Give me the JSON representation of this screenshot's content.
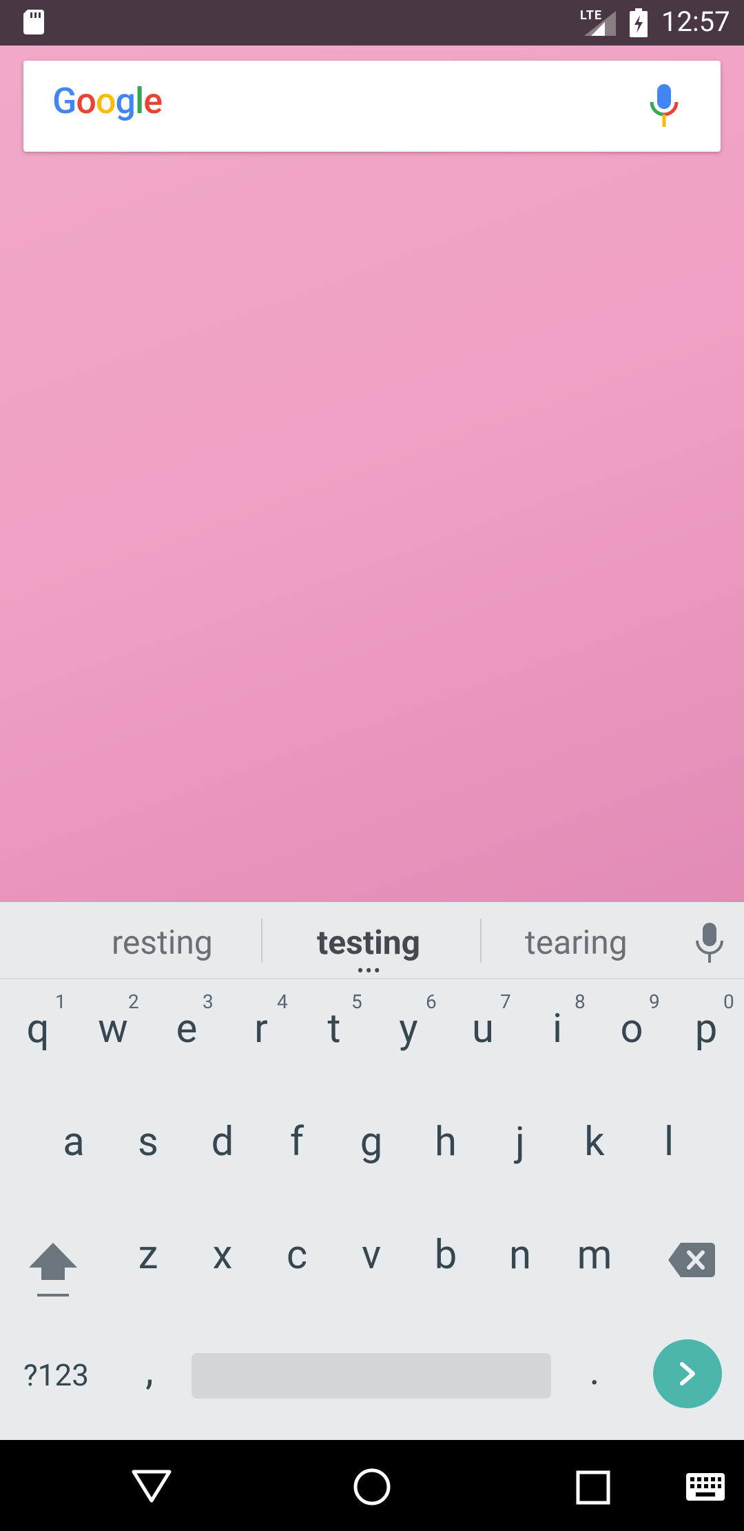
{
  "status_bar": {
    "network_label": "LTE",
    "time": "12:57"
  },
  "search_widget": {
    "logo_text": "Google",
    "logo_colors": [
      "#4285F4",
      "#EA4335",
      "#FBBC05",
      "#4285F4",
      "#34A853",
      "#EA4335"
    ],
    "mic_icon": "mic-icon"
  },
  "keyboard": {
    "suggestions": [
      "resting",
      "testing",
      "tearing"
    ],
    "row1_keys": [
      "q",
      "w",
      "e",
      "r",
      "t",
      "y",
      "u",
      "i",
      "o",
      "p"
    ],
    "row1_numbers": [
      "1",
      "2",
      "3",
      "4",
      "5",
      "6",
      "7",
      "8",
      "9",
      "0"
    ],
    "row2_keys": [
      "a",
      "s",
      "d",
      "f",
      "g",
      "h",
      "j",
      "k",
      "l"
    ],
    "row3_keys": [
      "z",
      "x",
      "c",
      "v",
      "b",
      "n",
      "m"
    ],
    "symbols_label": "?123",
    "comma": ",",
    "period": ".",
    "enter_color": "#4db6ac"
  },
  "nav_bar": {
    "icons": [
      "back-icon",
      "home-icon",
      "recents-icon",
      "keyboard-switch-icon"
    ]
  }
}
